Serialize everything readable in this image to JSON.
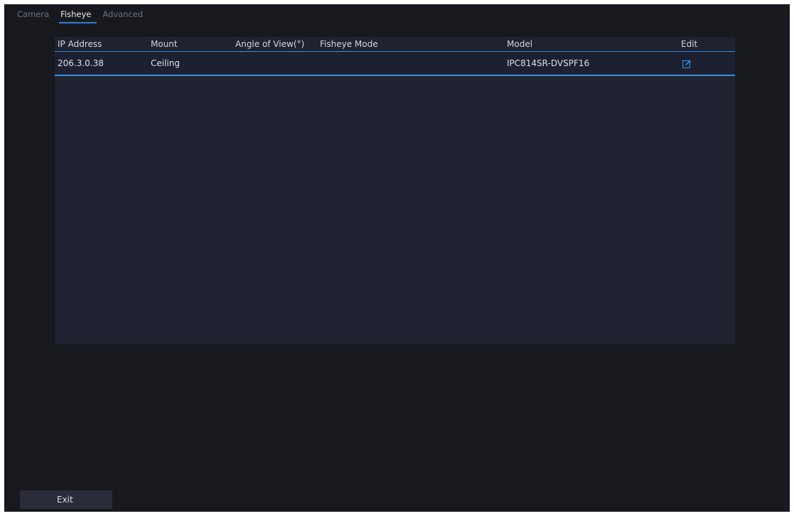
{
  "tabs": [
    {
      "label": "Camera",
      "active": false
    },
    {
      "label": "Fisheye",
      "active": true
    },
    {
      "label": "Advanced",
      "active": false
    }
  ],
  "table": {
    "columns": [
      "IP Address",
      "Mount",
      "Angle of View(°)",
      "Fisheye Mode",
      "Model",
      "Edit"
    ],
    "rows": [
      {
        "ip_address": "206.3.0.38",
        "mount": "Ceiling",
        "angle_of_view": "",
        "fisheye_mode": "",
        "model": "IPC814SR-DVSPF16",
        "edit_icon": "edit-icon"
      }
    ]
  },
  "footer": {
    "exit_label": "Exit"
  },
  "colors": {
    "accent": "#3a8fdd",
    "background": "#17191e",
    "panel": "#1f2230"
  }
}
